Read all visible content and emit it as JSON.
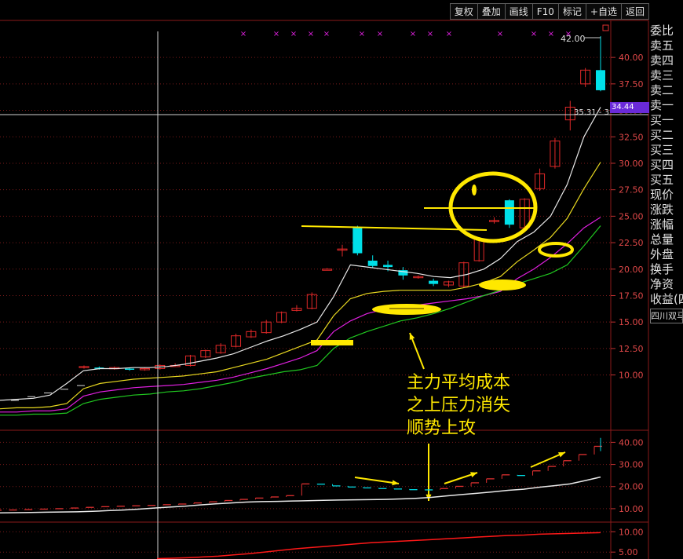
{
  "toolbar": {
    "buttons": [
      "复权",
      "叠加",
      "画线",
      "F10",
      "标记",
      "+自选",
      "返回"
    ]
  },
  "side_panel": {
    "labels": [
      "委比",
      "卖五",
      "卖四",
      "卖三",
      "卖二",
      "卖一",
      "买一",
      "买二",
      "买三",
      "买四",
      "买五",
      "现价",
      "涨跌",
      "涨幅",
      "总量",
      "外盘",
      "换手",
      "净资",
      "收益(四"
    ],
    "stock_name": "四川双马"
  },
  "price_axis": {
    "current_price": "34.44",
    "peak_label": "42.00",
    "crosshair_readout": "35.31 - 3"
  },
  "annotation": {
    "lines": [
      "主力平均成本",
      "之上压力消失",
      "顺势上攻"
    ]
  },
  "colors": {
    "up": "#e02828",
    "down": "#00e0e8",
    "annotation": "#ffe800",
    "ma_white": "#e8e8e8",
    "ma_yellow": "#e8d820",
    "ma_magenta": "#e020e0",
    "ma_green": "#20c820",
    "current_price_bg": "#6a2ad8"
  },
  "chart_data": [
    {
      "type": "candlestick",
      "title": "",
      "yticks": [
        "10.00",
        "12.50",
        "15.00",
        "17.50",
        "20.00",
        "22.50",
        "25.00",
        "27.50",
        "30.00",
        "32.50",
        "35.00",
        "37.50",
        "40.00"
      ],
      "ylim": [
        5.0,
        43.2
      ],
      "grid": true,
      "candles": [
        {
          "o": 10.8,
          "h": 10.9,
          "l": 10.6,
          "c": 10.8
        },
        {
          "o": 10.7,
          "h": 10.8,
          "l": 10.5,
          "c": 10.6
        },
        {
          "o": 10.6,
          "h": 10.8,
          "l": 10.5,
          "c": 10.7
        },
        {
          "o": 10.6,
          "h": 10.7,
          "l": 10.4,
          "c": 10.5
        },
        {
          "o": 10.5,
          "h": 10.7,
          "l": 10.4,
          "c": 10.6
        },
        {
          "o": 10.6,
          "h": 11.0,
          "l": 10.5,
          "c": 10.9
        },
        {
          "o": 10.9,
          "h": 11.1,
          "l": 10.8,
          "c": 10.9
        },
        {
          "o": 10.9,
          "h": 11.9,
          "l": 10.8,
          "c": 11.8
        },
        {
          "o": 11.7,
          "h": 12.4,
          "l": 11.6,
          "c": 12.3
        },
        {
          "o": 12.1,
          "h": 13.0,
          "l": 12.0,
          "c": 12.8
        },
        {
          "o": 12.7,
          "h": 13.9,
          "l": 12.6,
          "c": 13.7
        },
        {
          "o": 13.6,
          "h": 14.3,
          "l": 13.5,
          "c": 14.1
        },
        {
          "o": 14.0,
          "h": 15.2,
          "l": 13.9,
          "c": 15.0
        },
        {
          "o": 15.0,
          "h": 16.0,
          "l": 14.9,
          "c": 15.9
        },
        {
          "o": 16.1,
          "h": 16.6,
          "l": 16.0,
          "c": 16.3
        },
        {
          "o": 16.3,
          "h": 17.8,
          "l": 16.2,
          "c": 17.6
        },
        {
          "o": 20.0,
          "h": 20.1,
          "l": 20.0,
          "c": 20.0
        },
        {
          "o": 21.9,
          "h": 22.3,
          "l": 21.2,
          "c": 21.9
        },
        {
          "o": 23.9,
          "h": 24.1,
          "l": 21.3,
          "c": 21.5
        },
        {
          "o": 20.8,
          "h": 21.3,
          "l": 20.1,
          "c": 20.3
        },
        {
          "o": 20.4,
          "h": 20.8,
          "l": 19.8,
          "c": 20.2
        },
        {
          "o": 19.9,
          "h": 20.2,
          "l": 19.0,
          "c": 19.4
        },
        {
          "o": 19.3,
          "h": 19.4,
          "l": 19.1,
          "c": 19.3
        },
        {
          "o": 18.9,
          "h": 19.1,
          "l": 18.4,
          "c": 18.6
        },
        {
          "o": 18.5,
          "h": 18.9,
          "l": 18.3,
          "c": 18.8
        },
        {
          "o": 18.4,
          "h": 20.7,
          "l": 18.2,
          "c": 20.6
        },
        {
          "o": 20.8,
          "h": 23.0,
          "l": 20.7,
          "c": 22.8
        },
        {
          "o": 24.6,
          "h": 24.9,
          "l": 24.3,
          "c": 24.6
        },
        {
          "o": 26.5,
          "h": 26.6,
          "l": 23.9,
          "c": 24.2
        },
        {
          "o": 23.9,
          "h": 26.7,
          "l": 23.7,
          "c": 26.6
        },
        {
          "o": 27.6,
          "h": 29.5,
          "l": 27.4,
          "c": 29.0
        },
        {
          "o": 29.7,
          "h": 32.4,
          "l": 29.5,
          "c": 32.1
        },
        {
          "o": 34.1,
          "h": 35.9,
          "l": 33.1,
          "c": 35.3
        },
        {
          "o": 37.5,
          "h": 39.0,
          "l": 37.2,
          "c": 38.8
        },
        {
          "o": 38.8,
          "h": 42.0,
          "l": 36.8,
          "c": 36.9
        }
      ],
      "ma_series": [
        {
          "name": "",
          "color": "#e8e8e8",
          "values": [
            7.6,
            7.7,
            7.8,
            8.1,
            9.2,
            10.4,
            10.6,
            10.6,
            10.7,
            10.7,
            10.8,
            11.0,
            11.3,
            11.6,
            12.0,
            12.6,
            13.2,
            13.7,
            14.3,
            15.0,
            17.4,
            20.4,
            20.2,
            20.0,
            19.8,
            19.6,
            19.3,
            19.2,
            19.5,
            20.0,
            21.0,
            22.6,
            23.5,
            25.0,
            28.0,
            32.5,
            35.3
          ]
        },
        {
          "name": "",
          "color": "#e8d820",
          "values": [
            6.8,
            6.9,
            6.9,
            7.0,
            7.3,
            8.7,
            9.2,
            9.4,
            9.6,
            9.7,
            9.8,
            9.9,
            10.1,
            10.3,
            10.7,
            11.1,
            11.5,
            12.1,
            12.7,
            13.3,
            15.6,
            17.2,
            17.7,
            17.9,
            18.0,
            18.0,
            18.0,
            18.0,
            18.3,
            18.7,
            19.3,
            20.7,
            21.8,
            23.0,
            24.8,
            27.6,
            30.1
          ]
        },
        {
          "name": "",
          "color": "#e020e0",
          "values": [
            6.5,
            6.5,
            6.6,
            6.6,
            6.8,
            8.0,
            8.4,
            8.6,
            8.8,
            8.9,
            9.0,
            9.1,
            9.3,
            9.5,
            9.8,
            10.2,
            10.6,
            11.1,
            11.6,
            12.3,
            14.1,
            15.1,
            15.8,
            16.2,
            16.5,
            16.6,
            16.8,
            17.0,
            17.2,
            17.5,
            17.9,
            19.1,
            20.0,
            21.1,
            22.4,
            23.9,
            24.9
          ]
        },
        {
          "name": "",
          "color": "#20c820",
          "values": [
            6.2,
            6.2,
            6.3,
            6.3,
            6.4,
            7.3,
            7.7,
            7.9,
            8.1,
            8.2,
            8.4,
            8.5,
            8.7,
            9.0,
            9.3,
            9.7,
            10.0,
            10.3,
            10.5,
            10.9,
            12.5,
            13.5,
            14.1,
            14.6,
            15.1,
            15.4,
            15.8,
            16.3,
            16.9,
            17.5,
            18.0,
            18.6,
            19.1,
            19.6,
            20.4,
            22.2,
            24.1
          ]
        }
      ]
    },
    {
      "type": "line",
      "title": "",
      "yticks": [
        "10.00",
        "20.00",
        "30.00",
        "40.00"
      ],
      "ylim": [
        5.0,
        44.4
      ],
      "grid": true,
      "cost_line": [
        8.1,
        8.2,
        8.3,
        8.4,
        8.5,
        8.6,
        8.8,
        9.1,
        9.4,
        9.8,
        10.3,
        10.7,
        11.1,
        11.7,
        12.2,
        12.6,
        13.0,
        13.2,
        13.3,
        13.5,
        13.6,
        13.8,
        13.9,
        14.0,
        14.1,
        14.2,
        14.4,
        14.7,
        15.1,
        15.8,
        16.4,
        17.0,
        17.6,
        18.3,
        18.8,
        19.7,
        20.4,
        21.2,
        22.7,
        24.3
      ],
      "step_line": [
        9.3,
        9.4,
        9.6,
        9.8,
        10.0,
        10.3,
        10.6,
        10.9,
        11.1,
        11.3,
        11.5,
        11.8,
        12.1,
        12.6,
        13.1,
        13.7,
        14.2,
        14.8,
        15.3,
        15.9,
        21.2,
        21.1,
        20.3,
        19.8,
        19.4,
        19.1,
        18.9,
        18.6,
        18.5,
        19.1,
        20.1,
        21.7,
        23.5,
        25.3,
        25.0,
        27.1,
        29.1,
        31.7,
        34.5,
        38.2
      ]
    },
    {
      "type": "line",
      "title": "",
      "yticks": [
        "10.00",
        "5.00"
      ],
      "ylim": [
        3.3,
        11.8
      ],
      "grid": true,
      "red_line": [
        3.4,
        3.5,
        3.6,
        3.8,
        4.0,
        4.3,
        4.6,
        5.0,
        5.4,
        5.8,
        6.1,
        6.4,
        6.7,
        7.0,
        7.3,
        7.5,
        7.7,
        7.9,
        8.1,
        8.3,
        8.5,
        8.7,
        8.9,
        9.1,
        9.2,
        9.4,
        9.5,
        9.6,
        9.7,
        9.8
      ]
    }
  ]
}
